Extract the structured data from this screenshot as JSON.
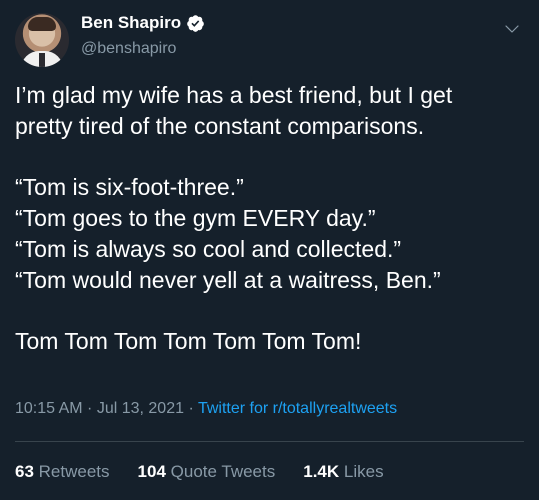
{
  "author": {
    "display_name": "Ben Shapiro",
    "handle": "@benshapiro",
    "verified": true,
    "avatar_icon": "profile-photo"
  },
  "tweet": {
    "lines": [
      "I’m glad my wife has a best friend, but I get",
      "pretty tired of the constant comparisons.",
      "“Tom is six-foot-three.”",
      "“Tom goes to the gym EVERY day.”",
      "“Tom is always so cool and collected.”",
      "“Tom would never yell at a waitress, Ben.”",
      "Tom Tom Tom Tom Tom Tom Tom!"
    ]
  },
  "meta": {
    "timestamp": "10:15 AM · Jul 13, 2021 · ",
    "source": "Twitter for r/totallyrealtweets"
  },
  "stats": {
    "retweets_count": "63",
    "retweets_label": "Retweets",
    "quote_count": "104",
    "quote_label": "Quote Tweets",
    "likes_count": "1.4K",
    "likes_label": "Likes"
  },
  "colors": {
    "background": "#15202b",
    "secondary_text": "#8899a6",
    "accent": "#1da1f2",
    "divider": "#38444d"
  }
}
